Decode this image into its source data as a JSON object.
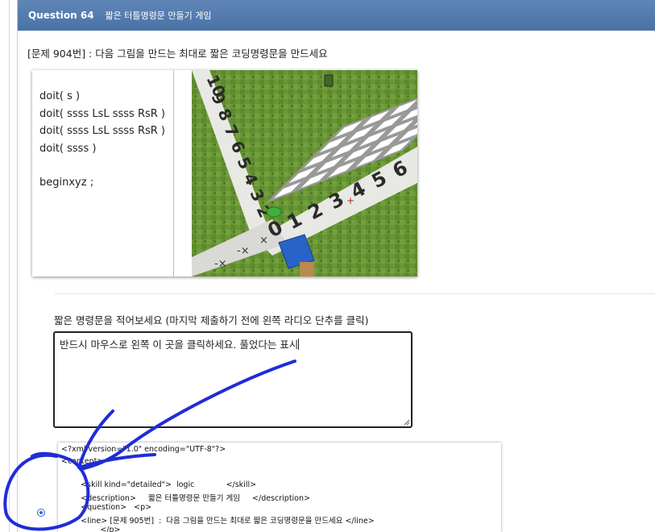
{
  "question": {
    "number": "Question 64",
    "title": "짧은 터틀명령문 만들기 게임"
  },
  "prompt": "[문제 904번] : 다음 그림을 만드는 최대로 짧은 코딩명령문을 만드세요",
  "code_lines": [
    "doit( s )",
    "doit( ssss LsL  ssss RsR )",
    "doit( ssss LsL  ssss RsR )",
    "doit( ssss )",
    "",
    "beginxyz ;"
  ],
  "board": {
    "left_numbers": "109876543210",
    "bottom_numbers": "123456",
    "grid_cells": 25
  },
  "instruction": "짧은 명령문을 적어보세요 (마지막 제출하기 전에 왼쪽 라디오 단추를 클릭)",
  "answer_text": "반드시 마우스로 왼쪽 이 곳을 클릭하세요. 풀었다는 표시",
  "xml_lines": [
    "<?xml version=\"1.0\" encoding=\"UTF-8\"?>",
    "<content>",
    "",
    "        <skill kind=\"detailed\">  logic             </skill>",
    "        <description>     짧은 터틀명령문 만들기 게임     </description>",
    "        <question>   <p>",
    "        <line> [문제 905번]  :  다음 그림을 만드는 최대로 짧은 코딩명령문을 만드세요 </line>",
    "                </p>"
  ],
  "colors": {
    "header_bg": "#4f78ab",
    "annotation_blue": "#1f2cd8",
    "grass": "#5f8b2f",
    "radio_blue": "#2f63d6"
  }
}
